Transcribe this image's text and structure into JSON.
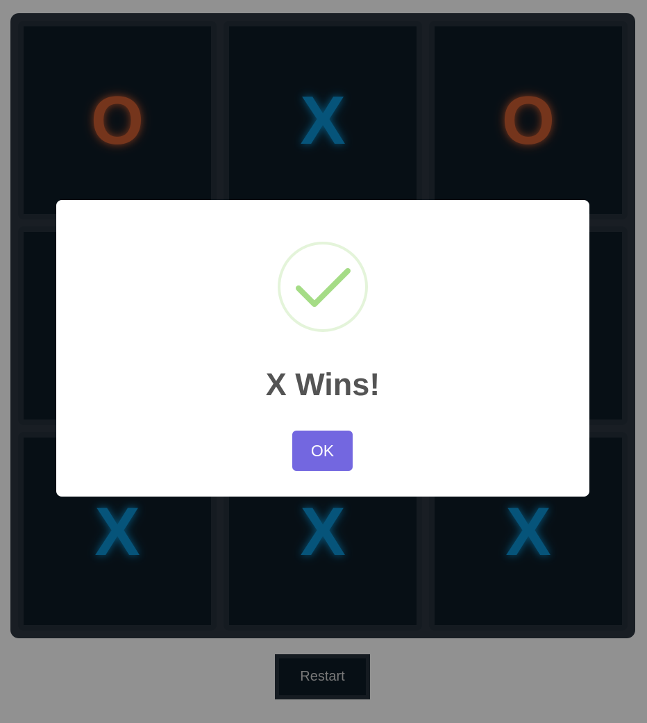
{
  "board": {
    "cells": [
      "O",
      "X",
      "O",
      "",
      "",
      "",
      "X",
      "X",
      "X"
    ],
    "colors": {
      "x": "#0a8ccc",
      "o": "#c4592f",
      "board_bg": "#2a333d",
      "cell_bg": "#0d1a24"
    }
  },
  "controls": {
    "restart_label": "Restart"
  },
  "modal": {
    "icon": "success-check-icon",
    "title": "X Wins!",
    "ok_label": "OK",
    "accent": "#7367e0",
    "icon_color": "#a5dc86"
  }
}
